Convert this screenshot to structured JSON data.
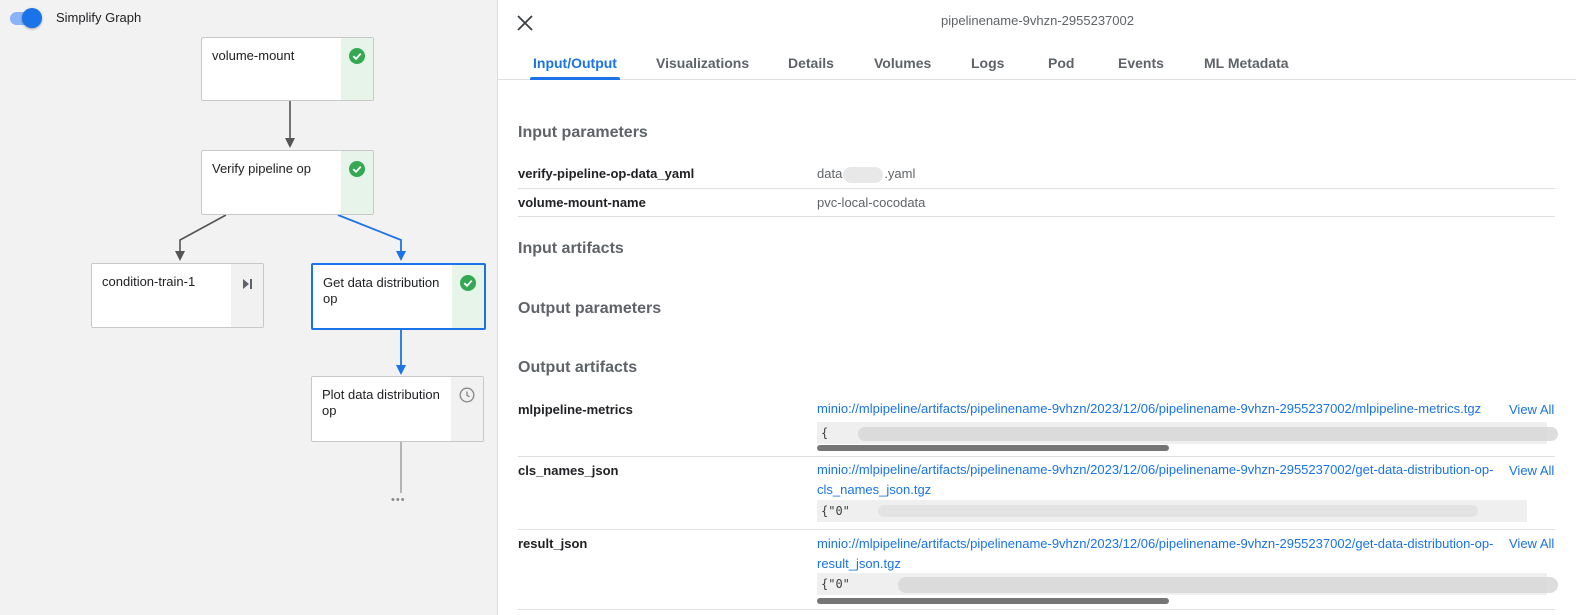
{
  "graph": {
    "toggle_label": "Simplify Graph",
    "more_glyph": "•••",
    "nodes": [
      {
        "name": "volume-mount",
        "status": "succeeded"
      },
      {
        "name": "Verify pipeline op",
        "status": "succeeded"
      },
      {
        "name": "condition-train-1",
        "status": "skipped"
      },
      {
        "name": "Get data distribution op",
        "status": "succeeded",
        "selected": true
      },
      {
        "name": "Plot data distribution op",
        "status": "pending"
      }
    ],
    "colors": {
      "success": "#34a853",
      "selected": "#1a73e8",
      "edge": "#555555"
    }
  },
  "detail": {
    "run_title": "pipelinename-9vhzn-2955237002",
    "tabs": [
      "Input/Output",
      "Visualizations",
      "Details",
      "Volumes",
      "Logs",
      "Pod",
      "Events",
      "ML Metadata"
    ],
    "active_tab": "Input/Output",
    "input_parameters": {
      "title": "Input parameters",
      "rows": [
        {
          "key": "verify-pipeline-op-data_yaml",
          "value_prefix": "data",
          "value_suffix": ".yaml"
        },
        {
          "key": "volume-mount-name",
          "value": "pvc-local-cocodata"
        }
      ]
    },
    "input_artifacts_title": "Input artifacts",
    "output_parameters_title": "Output parameters",
    "output_artifacts": {
      "title": "Output artifacts",
      "view_all_label": "View All",
      "rows": [
        {
          "key": "mlpipeline-metrics",
          "link": "minio://mlpipeline/artifacts/pipelinename-9vhzn/2023/12/06/pipelinename-9vhzn-2955237002/mlpipeline-metrics.tgz",
          "preview": "{"
        },
        {
          "key": "cls_names_json",
          "link": "minio://mlpipeline/artifacts/pipelinename-9vhzn/2023/12/06/pipelinename-9vhzn-2955237002/get-data-distribution-op-cls_names_json.tgz",
          "preview": "{\"0\""
        },
        {
          "key": "result_json",
          "link": "minio://mlpipeline/artifacts/pipelinename-9vhzn/2023/12/06/pipelinename-9vhzn-2955237002/get-data-distribution-op-result_json.tgz",
          "preview": "{\"0\""
        }
      ]
    }
  }
}
